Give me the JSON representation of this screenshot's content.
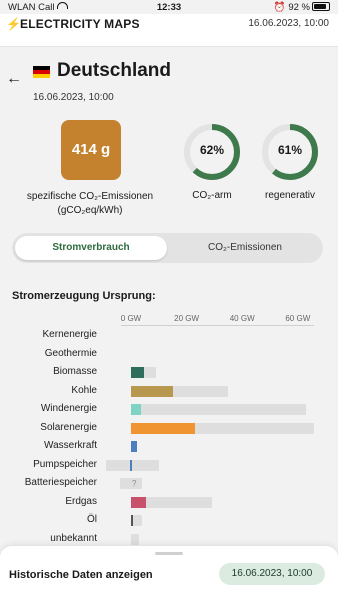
{
  "status_bar": {
    "carrier": "WLAN Call",
    "time": "12:33",
    "battery": "92 %"
  },
  "app_bar": {
    "title": "ELECTRICITY MAPS",
    "date": "16.06.2023, 10:00"
  },
  "zone": {
    "name": "Deutschland",
    "datetime": "16.06.2023, 10:00"
  },
  "metrics": {
    "intensity_value": "414 g",
    "intensity_label_line1": "spezifische CO₂-Emissionen",
    "intensity_label_line2": "(gCO₂eq/kWh)",
    "low_carbon_percent": "62%",
    "low_carbon_fraction": 0.62,
    "low_carbon_label": "CO₂-arm",
    "renewable_percent": "61%",
    "renewable_fraction": 0.61,
    "renewable_label": "regenerativ"
  },
  "toggle": {
    "active": "Stromverbrauch",
    "inactive": "CO₂-Emissionen"
  },
  "section_title": "Stromerzeugung Ursprung:",
  "chart_data": {
    "type": "bar",
    "orientation": "horizontal",
    "xlim": [
      0,
      70
    ],
    "ticks": [
      0,
      20,
      40,
      60
    ],
    "tick_labels": [
      "0 GW",
      "20 GW",
      "40 GW",
      "60 GW"
    ],
    "categories": [
      "Kernenergie",
      "Geothermie",
      "Biomasse",
      "Kohle",
      "Windenergie",
      "Solarenergie",
      "Wasserkraft",
      "Pumpspeicher",
      "Batteriespeicher",
      "Erdgas",
      "Öl",
      "unbekannt"
    ],
    "series": [
      {
        "values": [
          0,
          0,
          4.5,
          15,
          3.5,
          23,
          2,
          -0.5,
          0,
          5.5,
          0.5,
          0
        ]
      }
    ],
    "capacity": [
      0,
      0,
      9,
      35,
      63,
      66,
      2,
      10,
      4,
      29,
      4,
      3
    ],
    "capacity_min": [
      0,
      0,
      0,
      0,
      0,
      0,
      0,
      -9,
      -4,
      0,
      0,
      0
    ],
    "colors": [
      "#9b59b6",
      "#c0392b",
      "#2f6e5c",
      "#b8984e",
      "#7fd3c3",
      "#f09431",
      "#4a80c2",
      "#4a80c2",
      "#999999",
      "#c7526b",
      "#555555",
      "#bbbbbb"
    ],
    "unknown_marker": "?"
  },
  "bottom_sheet": {
    "label": "Historische Daten anzeigen",
    "date": "16.06.2023, 10:00"
  }
}
